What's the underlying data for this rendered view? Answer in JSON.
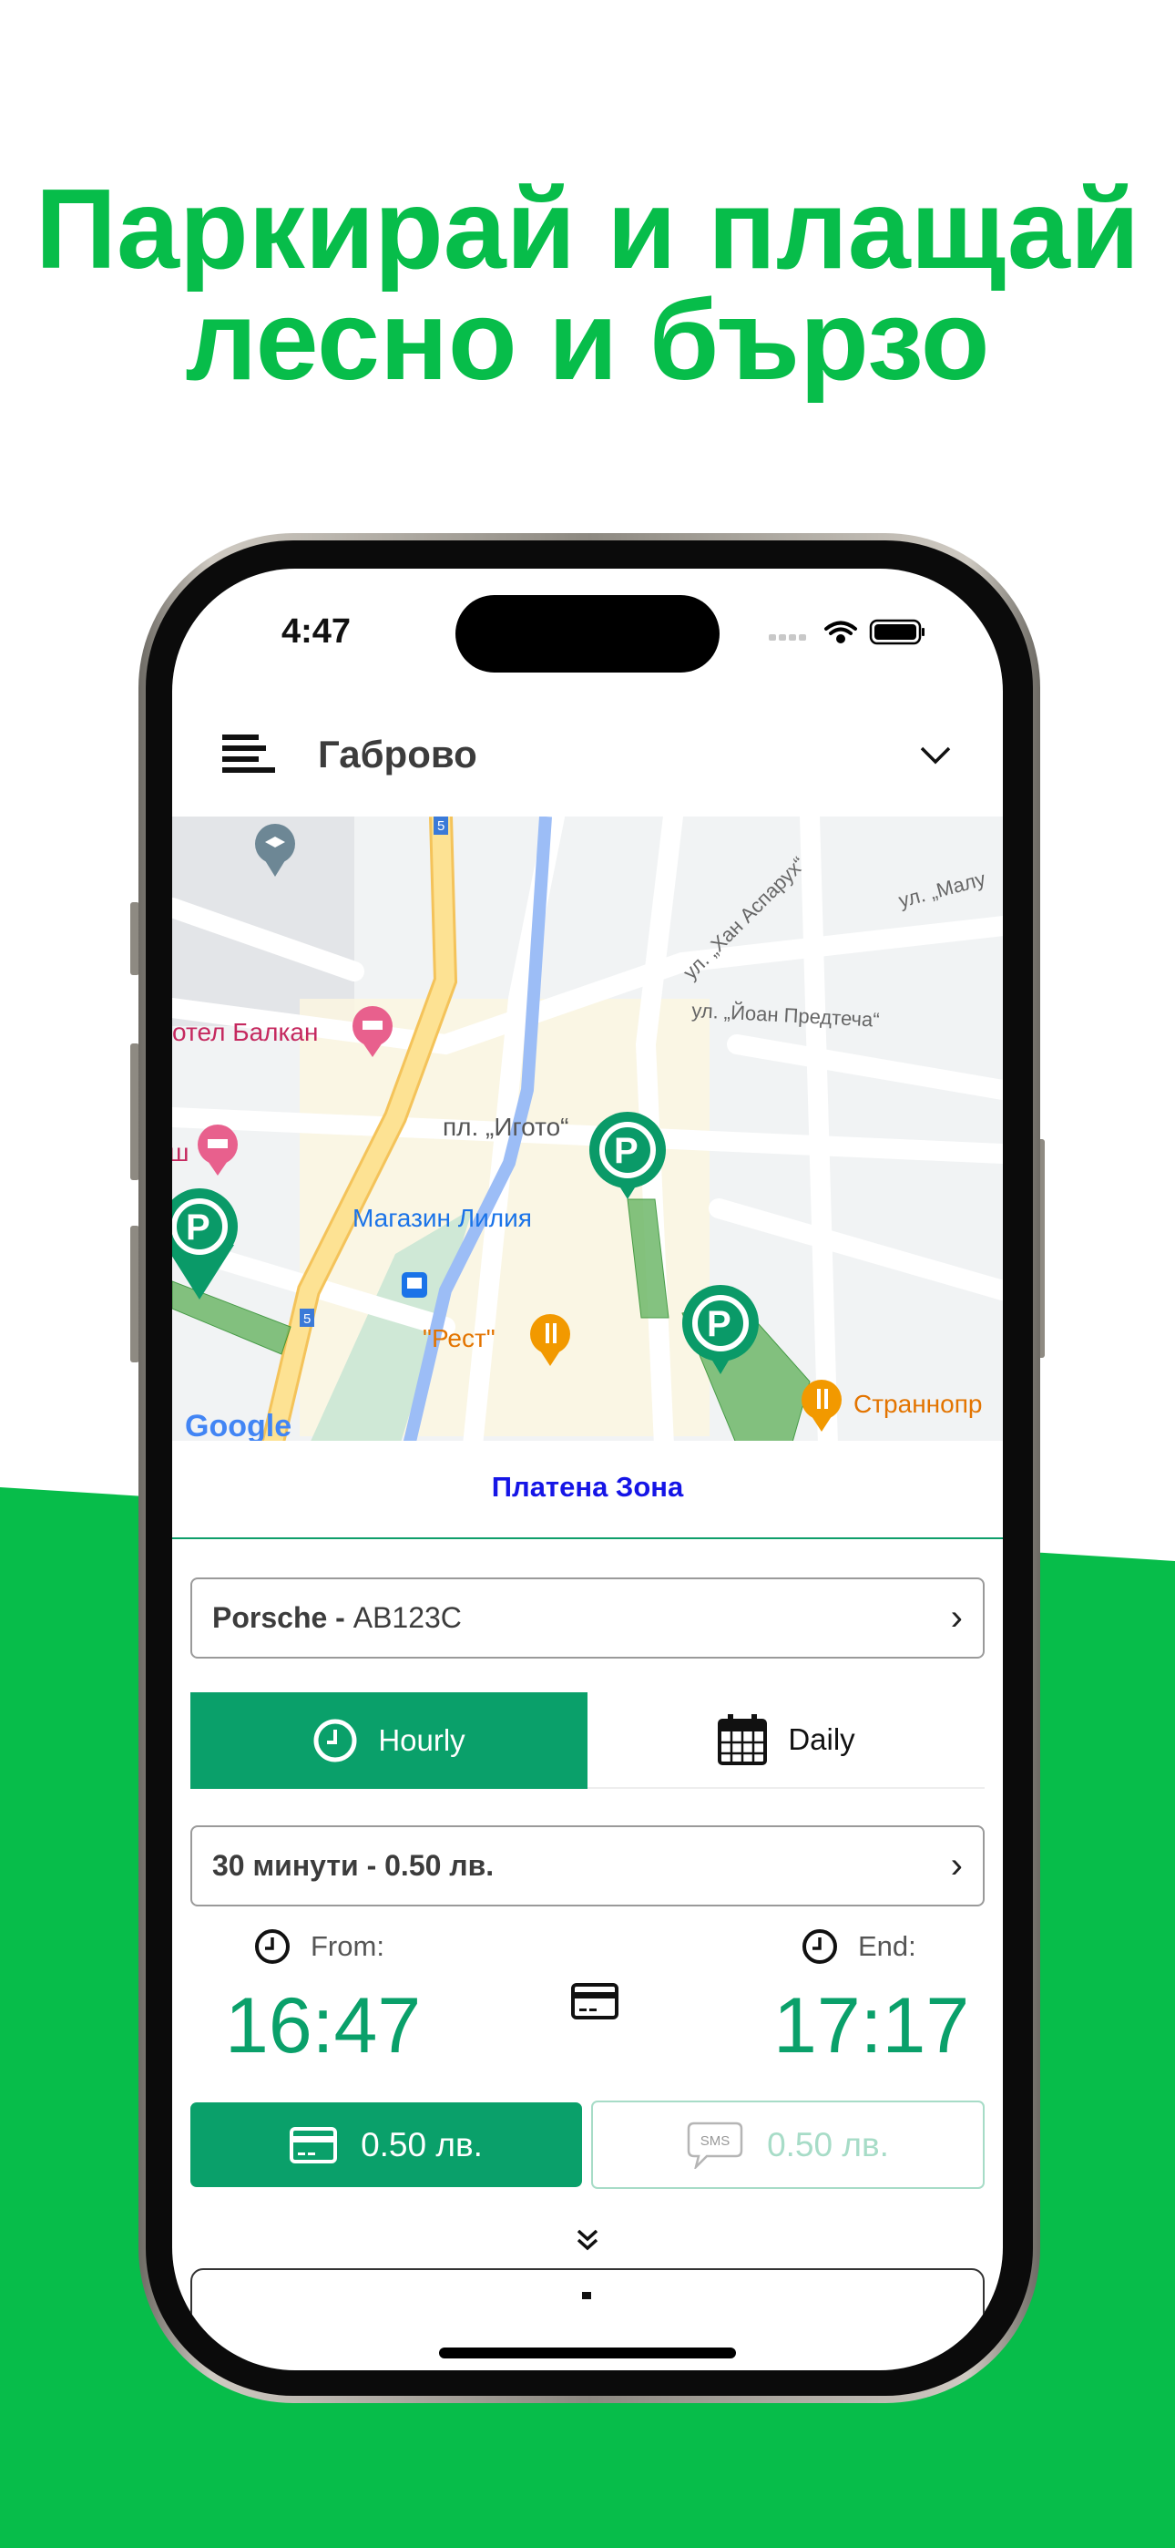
{
  "headline": {
    "line1": "Паркирай и плащай",
    "line2": "лесно и бързо"
  },
  "colors": {
    "brand_green": "#07bd4a",
    "app_green": "#0aa06a",
    "zone_title": "#1515e6"
  },
  "status_bar": {
    "time": "4:47"
  },
  "header": {
    "city": "Габрово",
    "menu_icon": "hamburger-icon",
    "dropdown_icon": "chevron-down-icon"
  },
  "map": {
    "labels": {
      "hotel": "отел Балкан",
      "hotel2": "ш",
      "square": "пл. „Игото“",
      "shop": "Магазин Лилия",
      "rest": "\"Рест\"",
      "strannopr": "Страннопр",
      "street1": "ул. „Хан Аспарух“",
      "street2": "ул. „Малу",
      "street3": "ул. „Йоан Предтеча“",
      "road_no": "5",
      "google": "Google"
    }
  },
  "zone": {
    "title": "Платена Зона"
  },
  "vehicle": {
    "make": "Porsche - ",
    "plate": "AB123C"
  },
  "tabs": [
    {
      "label": "Hourly",
      "active": true
    },
    {
      "label": "Daily",
      "active": false
    }
  ],
  "duration": {
    "label": "30 минути - 0.50 лв."
  },
  "time_range": {
    "from_label": "From:",
    "from": "16:47",
    "end_label": "End:",
    "end": "17:17"
  },
  "payment": {
    "card_amount": "0.50 лв.",
    "sms_amount": "0.50 лв.",
    "sms_badge": "SMS"
  }
}
